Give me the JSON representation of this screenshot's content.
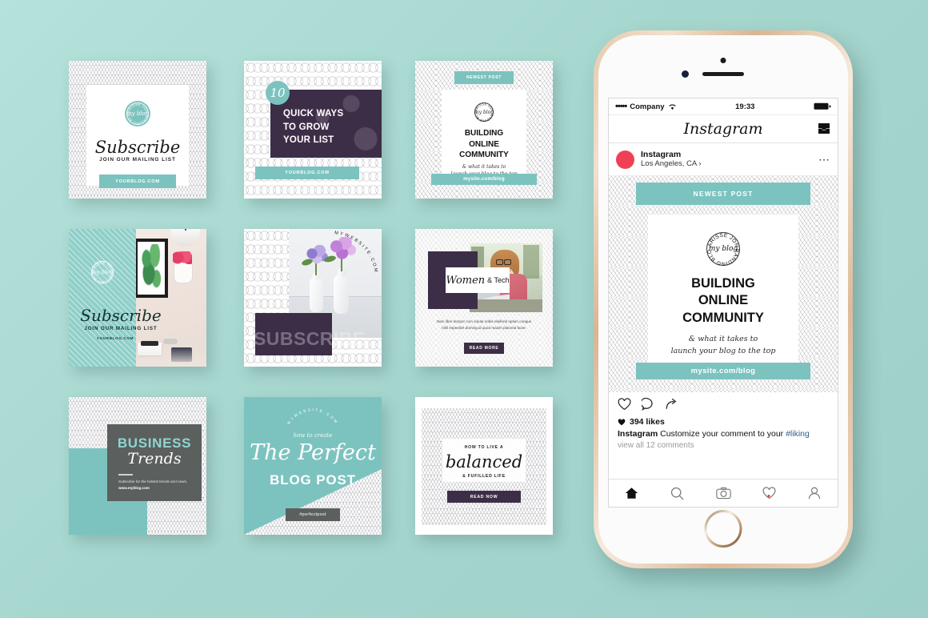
{
  "theme": {
    "background": "#a9d9d1",
    "teal": "#7cc3bf",
    "teal_light": "#8fcfc9",
    "plum": "#3d2e48",
    "gray_block": "#5b5f5e",
    "white": "#ffffff",
    "accent_red": "#ef4056"
  },
  "phone": {
    "status": {
      "signal_dots": "•••••",
      "carrier": "Company",
      "wifi_icon": "wifi-icon",
      "time": "19:33",
      "battery_icon": "battery-icon"
    },
    "navbar": {
      "logo": "Instagram",
      "inbox_icon": "inbox-icon"
    },
    "user": {
      "name": "Instagram",
      "location": "Los Angeles, CA ›",
      "more_icon": "more-options-icon",
      "avatar": "avatar"
    },
    "post": {
      "badge": "NEWEST POST",
      "stamp": {
        "top_text": "CHARISSE JONES",
        "bottom_text": "BRANDING BLOG",
        "center": "my blog"
      },
      "title_lines": [
        "BUILDING",
        "ONLINE",
        "COMMUNITY"
      ],
      "subtitle_lines": [
        "& what it takes to",
        "launch your blog to the top"
      ],
      "url_bar": "mysite.com/blog"
    },
    "actions": {
      "like_icon": "heart-icon",
      "comment_icon": "comment-icon",
      "share_icon": "share-icon"
    },
    "meta": {
      "likes": "394 likes",
      "like_heart_icon": "heart-filled-icon",
      "comment_author": "Instagram",
      "comment_text": " Customize your comment to your ",
      "comment_hashtag": "#liking",
      "view_all": "view all 12 comments"
    },
    "tabbar": [
      {
        "name": "home-icon",
        "active": true
      },
      {
        "name": "search-icon",
        "active": false
      },
      {
        "name": "camera-icon",
        "active": false
      },
      {
        "name": "activity-heart-icon",
        "active": false,
        "badge": true
      },
      {
        "name": "profile-icon",
        "active": false
      }
    ]
  },
  "cards": {
    "c1": {
      "stamp_top": "CHARISSE JONES",
      "stamp_bottom": "BRANDING BLOG",
      "stamp_center": "my blog",
      "title": "Subscribe",
      "subtitle": "JOIN OUR MAILING LIST",
      "button": "YOURBLOG.COM"
    },
    "c2": {
      "number": "10",
      "title_lines": [
        "QUICK WAYS",
        "TO GROW",
        "YOUR LIST"
      ],
      "button": "YOURBLOG.COM"
    },
    "c3": {
      "badge": "NEWEST POST",
      "stamp_top": "CHARISSE JONES",
      "stamp_bottom": "BRANDING BLOG",
      "stamp_center": "my blog",
      "title_lines": [
        "BUILDING",
        "ONLINE",
        "COMMUNITY"
      ],
      "subtitle_lines": [
        "& what it takes to",
        "launch your blog to the top"
      ],
      "url_bar": "mysite.com/blog"
    },
    "c4": {
      "stamp_top": "CHARISSE JONES",
      "stamp_bottom": "BRANDING BLOG",
      "stamp_center": "my blog",
      "title": "Subscribe",
      "subtitle": "JOIN OUR MAILING LIST",
      "url": "YOURBLOG.COM"
    },
    "c5": {
      "curved_text": "MYWEBSITE.COM",
      "overlay_word": "SUBSCRIBE"
    },
    "c6": {
      "title_script": "Women",
      "title_rest": "& Tech",
      "body": "Nam liber tempor cum soluta nobis eleifend option congue nihil imperdiet doming id quod mazim placerat facer.",
      "button": "READ MORE"
    },
    "c7": {
      "title_top": "BUSINESS",
      "title_script": "Trends",
      "body": "Subscribe for the hottest trends and news.",
      "url": "www.myblog.com"
    },
    "c8": {
      "curved_text": "MYWEBSITE.COM",
      "eyebrow": "how to create",
      "title_script": "The Perfect",
      "title_sub": "BLOG POST",
      "badge": "#perfectpost"
    },
    "c9": {
      "eyebrow": "HOW TO LIVE A",
      "title_script": "balanced",
      "subtitle": "& FUFILLED LIFE",
      "button": "READ NOW"
    }
  }
}
